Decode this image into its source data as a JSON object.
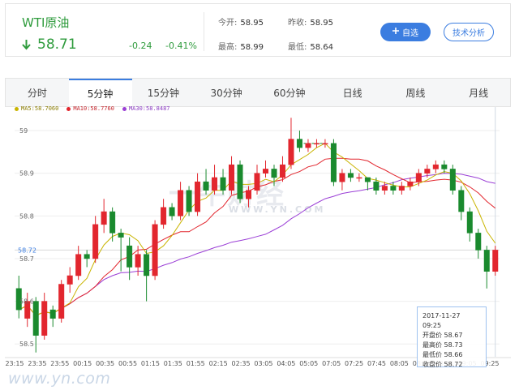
{
  "quote": {
    "name": "WTI原油",
    "price": "58.71",
    "change": "-0.24",
    "change_pct": "-0.41%",
    "stats": {
      "open_label": "今开:",
      "open": "58.95",
      "prev_close_label": "昨收:",
      "prev_close": "58.95",
      "high_label": "最高:",
      "high": "58.99",
      "low_label": "最低:",
      "low": "58.64"
    },
    "watch_label": "自选",
    "tech_label": "技术分析"
  },
  "tabs": [
    "分时",
    "5分钟",
    "15分钟",
    "30分钟",
    "60分钟",
    "日线",
    "周线",
    "月线"
  ],
  "active_tab_index": 1,
  "colors": {
    "up": "#e2262e",
    "down": "#1a8a2e",
    "ma5": "#c9b400",
    "ma10": "#e2262e",
    "ma30": "#9b3fd6",
    "accent": "#3b7de0"
  },
  "legend": {
    "ma5": "MA5:58.7060",
    "ma10": "MA10:58.7760",
    "ma30": "MA30:58.8487"
  },
  "y_ticks": [
    "59",
    "58.9",
    "58.8",
    "58.7",
    "58.6",
    "58.5"
  ],
  "price_marker": "58.72",
  "x_ticks": [
    "23:15",
    "23:35",
    "23:55",
    "00:15",
    "00:35",
    "00:55",
    "01:15",
    "01:35",
    "01:55",
    "02:15",
    "02:35",
    "03:05",
    "04:05",
    "05:05",
    "07:05",
    "07:25",
    "07:45",
    "08:05",
    "08:25",
    "08:45",
    "09:05",
    "09:25"
  ],
  "tooltip": {
    "date": "2017-11-27 09:25",
    "open_label": "开盘价",
    "open": "58.67",
    "high_label": "最高价",
    "high": "58.73",
    "low_label": "最低价",
    "low": "58.66",
    "close_label": "收盘价",
    "close": "58.72"
  },
  "watermark": {
    "logo": "一牛财经",
    "sub": "WWW.YN.COM",
    "url": "www.yn.com"
  },
  "chart_data": {
    "type": "candlestick",
    "ylim": [
      58.47,
      59.04
    ],
    "candles": [
      [
        58.63,
        58.58,
        58.66,
        58.56
      ],
      [
        58.56,
        58.6,
        58.62,
        58.54
      ],
      [
        58.6,
        58.52,
        58.61,
        58.48
      ],
      [
        58.52,
        58.6,
        58.62,
        58.51
      ],
      [
        58.58,
        58.56,
        58.59,
        58.54
      ],
      [
        58.56,
        58.64,
        58.65,
        58.55
      ],
      [
        58.64,
        58.66,
        58.68,
        58.62
      ],
      [
        58.66,
        58.71,
        58.73,
        58.65
      ],
      [
        58.71,
        58.7,
        58.72,
        58.68
      ],
      [
        58.7,
        58.78,
        58.8,
        58.69
      ],
      [
        58.78,
        58.81,
        58.84,
        58.76
      ],
      [
        58.81,
        58.76,
        58.82,
        58.74
      ],
      [
        58.76,
        58.75,
        58.77,
        58.67
      ],
      [
        58.73,
        58.68,
        58.75,
        58.65
      ],
      [
        58.68,
        58.71,
        58.73,
        58.66
      ],
      [
        58.71,
        58.66,
        58.72,
        58.6
      ],
      [
        58.66,
        58.78,
        58.79,
        58.65
      ],
      [
        58.78,
        58.82,
        58.84,
        58.77
      ],
      [
        58.82,
        58.8,
        58.83,
        58.79
      ],
      [
        58.8,
        58.86,
        58.88,
        58.79
      ],
      [
        58.86,
        58.81,
        58.87,
        58.8
      ],
      [
        58.81,
        58.88,
        58.9,
        58.8
      ],
      [
        58.88,
        58.86,
        58.91,
        58.85
      ],
      [
        58.86,
        58.89,
        58.92,
        58.85
      ],
      [
        58.89,
        58.86,
        58.91,
        58.85
      ],
      [
        58.86,
        58.92,
        58.94,
        58.85
      ],
      [
        58.92,
        58.84,
        58.93,
        58.83
      ],
      [
        58.84,
        58.86,
        58.87,
        58.82
      ],
      [
        58.86,
        58.9,
        58.92,
        58.85
      ],
      [
        58.9,
        58.91,
        58.93,
        58.89
      ],
      [
        58.91,
        58.89,
        58.92,
        58.87
      ],
      [
        58.89,
        58.92,
        58.94,
        58.88
      ],
      [
        58.92,
        58.98,
        59.03,
        58.91
      ],
      [
        58.98,
        58.96,
        59.0,
        58.95
      ],
      [
        58.96,
        58.97,
        58.98,
        58.95
      ],
      [
        58.97,
        58.97,
        58.98,
        58.96
      ],
      [
        58.97,
        58.97,
        58.98,
        58.96
      ],
      [
        58.97,
        58.88,
        58.98,
        58.87
      ],
      [
        58.88,
        58.9,
        58.91,
        58.86
      ],
      [
        58.9,
        58.89,
        58.91,
        58.88
      ],
      [
        58.89,
        58.89,
        58.9,
        58.88
      ],
      [
        58.89,
        58.88,
        58.89,
        58.86
      ],
      [
        58.88,
        58.86,
        58.89,
        58.85
      ],
      [
        58.86,
        58.87,
        58.88,
        58.85
      ],
      [
        58.87,
        58.86,
        58.88,
        58.85
      ],
      [
        58.86,
        58.87,
        58.88,
        58.85
      ],
      [
        58.87,
        58.88,
        58.89,
        58.86
      ],
      [
        58.88,
        58.9,
        58.91,
        58.87
      ],
      [
        58.9,
        58.91,
        58.92,
        58.89
      ],
      [
        58.91,
        58.92,
        58.93,
        58.9
      ],
      [
        58.92,
        58.91,
        58.93,
        58.9
      ],
      [
        58.91,
        58.86,
        58.92,
        58.85
      ],
      [
        58.86,
        58.81,
        58.87,
        58.79
      ],
      [
        58.81,
        58.76,
        58.82,
        58.74
      ],
      [
        58.76,
        58.72,
        58.77,
        58.7
      ],
      [
        58.72,
        58.67,
        58.73,
        58.63
      ],
      [
        58.67,
        58.72,
        58.73,
        58.66
      ]
    ]
  }
}
